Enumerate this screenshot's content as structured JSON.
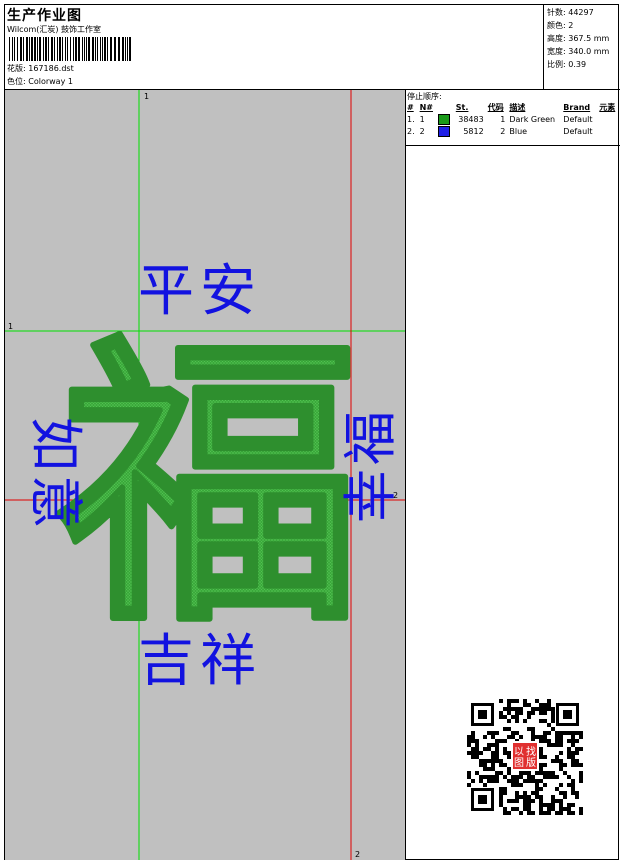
{
  "header": {
    "title": "生产作业图",
    "company": "Wilcom(汇炭) 鼓饰工作室",
    "design_label": "花版:",
    "design_value": "167186.dst",
    "colorway_label": "色位:",
    "colorway_value": "Colorway 1"
  },
  "stats": [
    {
      "label": "针数:",
      "value": "44297"
    },
    {
      "label": "颜色:",
      "value": "2"
    },
    {
      "label": "高度:",
      "value": "367.5 mm"
    },
    {
      "label": "宽度:",
      "value": "340.0 mm"
    },
    {
      "label": "比例:",
      "value": "0.39"
    }
  ],
  "stop_sequence": {
    "heading": "停止顺序:",
    "columns": [
      "#",
      "N#",
      "",
      "St.",
      "代码",
      "描述",
      "Brand",
      "元素"
    ],
    "rows": [
      {
        "num": "1.",
        "n": "1",
        "color": "#1a9a1a",
        "stitches": "38483",
        "code": "1",
        "desc": "Dark Green",
        "brand": "Default",
        "element": ""
      },
      {
        "num": "2.",
        "n": "2",
        "color": "#1f1fe6",
        "stitches": "5812",
        "code": "2",
        "desc": "Blue",
        "brand": "Default",
        "element": ""
      }
    ]
  },
  "canvas": {
    "main_char": "福",
    "top_text": "平安",
    "bottom_text": "吉祥",
    "left_text": "如意",
    "right_text": "幸福",
    "guide_labels": {
      "v1": "1",
      "h1": "1",
      "v2": "2",
      "h2": "2"
    },
    "colors": {
      "background": "#c0c0c0",
      "green": "#3aa83a",
      "blue": "#1212e0",
      "guide_green": "#00e000",
      "guide_red": "#e00000"
    }
  },
  "qr": {
    "stamp_text": [
      "以",
      "图",
      "找",
      "版"
    ]
  }
}
